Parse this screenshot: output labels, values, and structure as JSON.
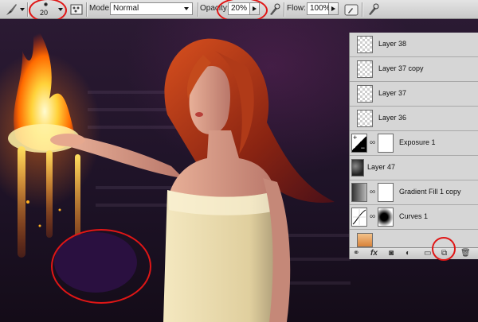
{
  "options_bar": {
    "brush_size": "20",
    "mode_label": "Mode:",
    "mode_value": "Normal",
    "opacity_label": "Opacity:",
    "opacity_value": "20%",
    "flow_label": "Flow:",
    "flow_value": "100%"
  },
  "layers_panel": {
    "layers": [
      {
        "name": "Layer 38",
        "kind": "pixel"
      },
      {
        "name": "Layer 37 copy",
        "kind": "pixel"
      },
      {
        "name": "Layer 37",
        "kind": "pixel"
      },
      {
        "name": "Layer 36",
        "kind": "pixel"
      },
      {
        "name": "Exposure 1",
        "kind": "adjustment",
        "icon": "exposure-icon"
      },
      {
        "name": "Layer 47",
        "kind": "pixel-dark"
      },
      {
        "name": "Gradient Fill 1 copy",
        "kind": "adjustment",
        "icon": "gradient-icon"
      },
      {
        "name": "Curves 1",
        "kind": "adjustment",
        "icon": "curves-icon"
      }
    ],
    "footer_icons": [
      "link-icon",
      "fx-icon",
      "mask-icon",
      "adjustment-icon",
      "folder-icon",
      "new-layer-icon",
      "trash-icon"
    ]
  },
  "colors": {
    "annotation_red": "#e01616",
    "painted_swatch": "#2a1040"
  }
}
